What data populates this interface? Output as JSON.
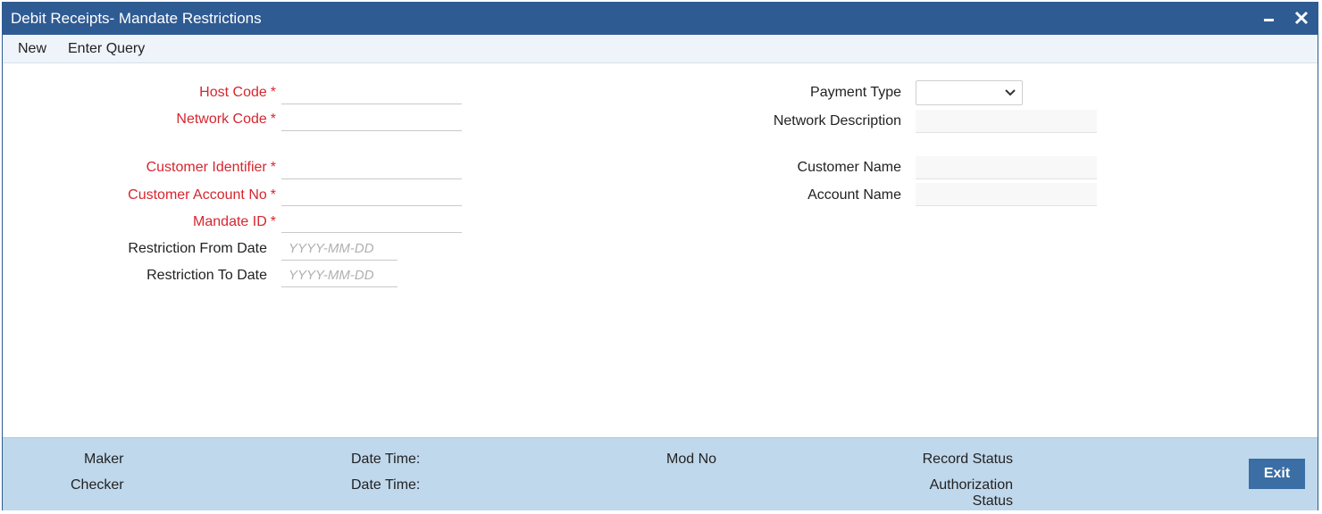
{
  "window": {
    "title": "Debit Receipts- Mandate Restrictions"
  },
  "menu": {
    "new_label": "New",
    "enter_query_label": "Enter Query"
  },
  "form": {
    "required_marker": "*",
    "host_code": {
      "label": "Host Code",
      "value": ""
    },
    "network_code": {
      "label": "Network Code",
      "value": ""
    },
    "customer_identifier": {
      "label": "Customer Identifier",
      "value": ""
    },
    "customer_account_no": {
      "label": "Customer Account No",
      "value": ""
    },
    "mandate_id": {
      "label": "Mandate ID",
      "value": ""
    },
    "restriction_from_date": {
      "label": "Restriction From Date",
      "placeholder": "YYYY-MM-DD"
    },
    "restriction_to_date": {
      "label": "Restriction To Date",
      "placeholder": "YYYY-MM-DD"
    },
    "payment_type": {
      "label": "Payment Type",
      "value": ""
    },
    "network_description": {
      "label": "Network Description",
      "value": ""
    },
    "customer_name": {
      "label": "Customer Name",
      "value": ""
    },
    "account_name": {
      "label": "Account Name",
      "value": ""
    }
  },
  "footer": {
    "maker_label": "Maker",
    "checker_label": "Checker",
    "date_time_label_1": "Date Time:",
    "date_time_label_2": "Date Time:",
    "mod_no_label": "Mod No",
    "record_status_label": "Record Status",
    "authorization_label": "Authorization",
    "status_label": "Status",
    "exit_label": "Exit"
  },
  "colors": {
    "title_bar": "#2f5b93",
    "required_text": "#d6262f",
    "footer_bg": "#c0d8ec",
    "exit_button": "#3a6ea5"
  }
}
